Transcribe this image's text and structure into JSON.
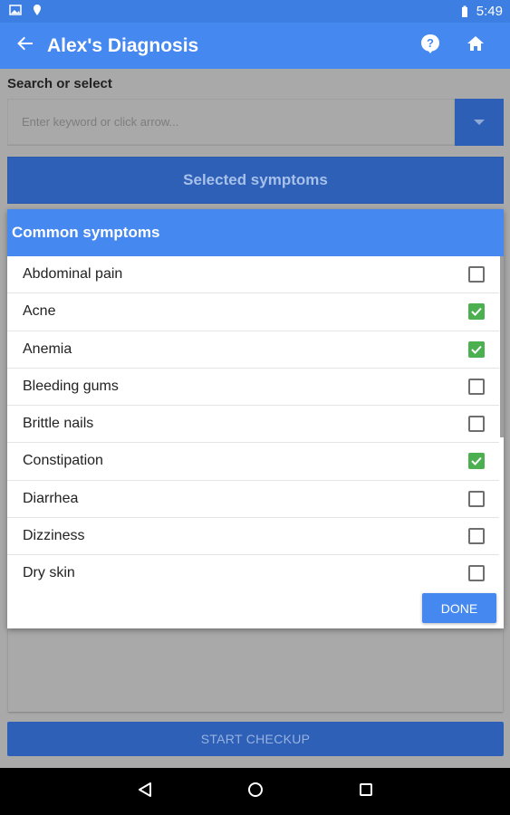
{
  "status_bar": {
    "time": "5:49"
  },
  "app_bar": {
    "title": "Alex's Diagnosis"
  },
  "search": {
    "label": "Search or select",
    "placeholder": "Enter keyword or click arrow..."
  },
  "selected_symptoms": {
    "label": "Selected symptoms"
  },
  "dialog": {
    "title": "Common symptoms",
    "done_label": "DONE",
    "symptoms": [
      {
        "label": "Abdominal pain",
        "checked": false
      },
      {
        "label": "Acne",
        "checked": true
      },
      {
        "label": "Anemia",
        "checked": true
      },
      {
        "label": "Bleeding gums",
        "checked": false
      },
      {
        "label": "Brittle nails",
        "checked": false
      },
      {
        "label": "Constipation",
        "checked": true
      },
      {
        "label": "Diarrhea",
        "checked": false
      },
      {
        "label": "Dizziness",
        "checked": false
      },
      {
        "label": "Dry skin",
        "checked": false
      }
    ]
  },
  "start_button": {
    "label": "START CHECKUP"
  },
  "colors": {
    "primary": "#4588f0",
    "primary_dark": "#2d60b6",
    "check_green": "#4caf50"
  },
  "icons": [
    "image-icon",
    "location-pin-icon",
    "battery-icon",
    "back-arrow-icon",
    "help-icon",
    "home-icon",
    "dropdown-arrow-icon",
    "check-icon",
    "nav-back-icon",
    "nav-home-icon",
    "nav-recents-icon"
  ]
}
